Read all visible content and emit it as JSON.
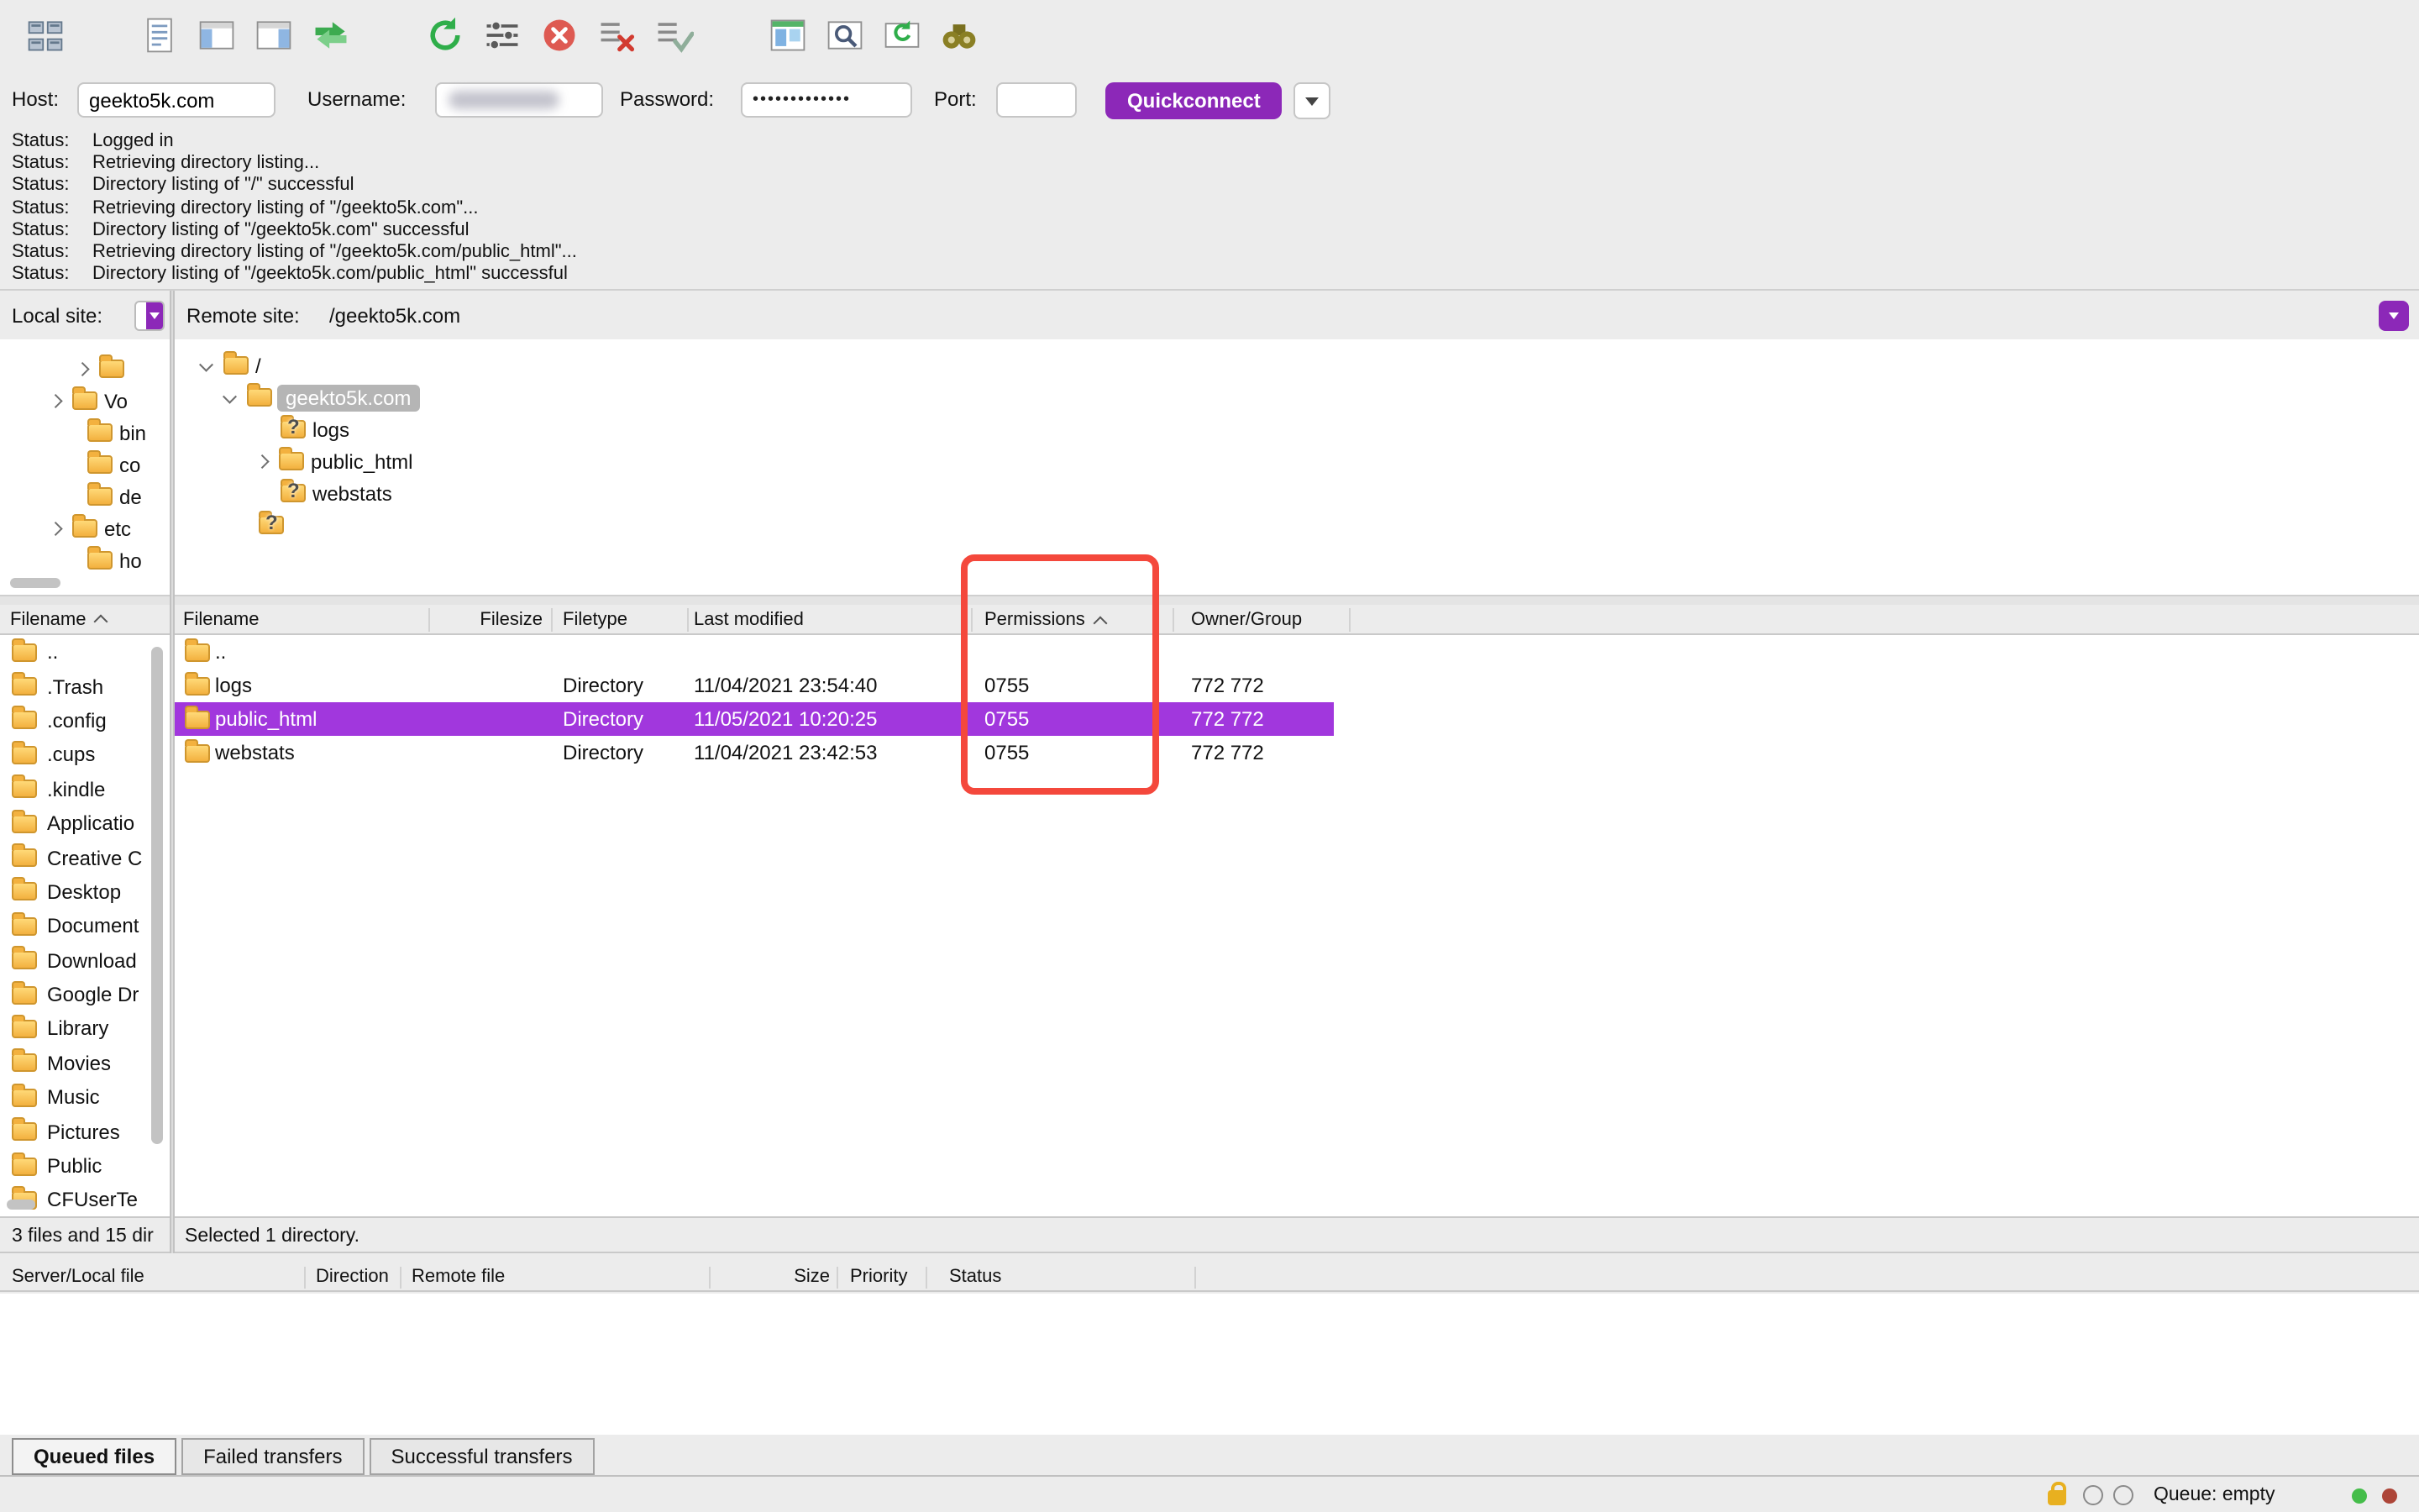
{
  "colors": {
    "selection": "#A137DD",
    "accent_purple": "#8C28B8",
    "highlight_box": "#F4483C",
    "folder": "#F3B13F"
  },
  "toolbar": {
    "icons": [
      "site-manager",
      "message-log-toggle",
      "local-tree-toggle",
      "remote-tree-toggle",
      "transfer-queue-toggle",
      "refresh",
      "filter",
      "cancel",
      "disconnect",
      "reconnect",
      "directory-comparison",
      "file-search",
      "synchronized-browsing",
      "find-files"
    ]
  },
  "quickconnect": {
    "host_label": "Host:",
    "host_value": "geekto5k.com",
    "username_label": "Username:",
    "username_value": "",
    "password_label": "Password:",
    "password_value": "•••••••••••••",
    "port_label": "Port:",
    "port_value": "",
    "button_label": "Quickconnect"
  },
  "status_log": {
    "lines": [
      {
        "label": "Status:",
        "message": "Logged in"
      },
      {
        "label": "Status:",
        "message": "Retrieving directory listing..."
      },
      {
        "label": "Status:",
        "message": "Directory listing of \"/\" successful"
      },
      {
        "label": "Status:",
        "message": "Retrieving directory listing of \"/geekto5k.com\"..."
      },
      {
        "label": "Status:",
        "message": "Directory listing of \"/geekto5k.com\" successful"
      },
      {
        "label": "Status:",
        "message": "Retrieving directory listing of \"/geekto5k.com/public_html\"..."
      },
      {
        "label": "Status:",
        "message": "Directory listing of \"/geekto5k.com/public_html\" successful"
      }
    ]
  },
  "site_bar": {
    "local_label": "Local site:",
    "remote_label": "Remote site:",
    "remote_value": "/geekto5k.com"
  },
  "local_tree": {
    "items": [
      {
        "label": "",
        "indent": 44,
        "chevron": "right"
      },
      {
        "label": "Vo",
        "indent": 28,
        "chevron": "right"
      },
      {
        "label": "bin",
        "indent": 52
      },
      {
        "label": "co",
        "indent": 52
      },
      {
        "label": "de",
        "indent": 52
      },
      {
        "label": "etc",
        "indent": 28,
        "chevron": "right"
      },
      {
        "label": "ho",
        "indent": 52
      }
    ]
  },
  "remote_tree": {
    "items": [
      {
        "label": "/",
        "indent": 14,
        "chevron": "down"
      },
      {
        "label": "geekto5k.com",
        "indent": 28,
        "chevron": "down",
        "selected": true
      },
      {
        "label": "logs",
        "indent": 63,
        "question": true
      },
      {
        "label": "public_html",
        "indent": 47,
        "chevron": "right"
      },
      {
        "label": "webstats",
        "indent": 63,
        "question": true
      },
      {
        "label": "",
        "indent": 50,
        "question": true
      }
    ]
  },
  "local_list": {
    "header": "Filename",
    "rows": [
      "..",
      ".Trash",
      ".config",
      ".cups",
      ".kindle",
      "Applicatio",
      "Creative C",
      "Desktop",
      "Document",
      "Download",
      "Google Dr",
      "Library",
      "Movies",
      "Music",
      "Pictures",
      "Public",
      "CFUserTe"
    ],
    "status": "3 files and 15 dir"
  },
  "remote_list": {
    "headers": [
      "Filename",
      "Filesize",
      "Filetype",
      "Last modified",
      "Permissions",
      "Owner/Group"
    ],
    "rows": [
      {
        "name": "..",
        "filesize": "",
        "filetype": "",
        "last_modified": "",
        "permissions": "",
        "owner_group": "",
        "selected": false
      },
      {
        "name": "logs",
        "filesize": "",
        "filetype": "Directory",
        "last_modified": "11/04/2021 23:54:40",
        "permissions": "0755",
        "owner_group": "772 772",
        "selected": false
      },
      {
        "name": "public_html",
        "filesize": "",
        "filetype": "Directory",
        "last_modified": "11/05/2021 10:20:25",
        "permissions": "0755",
        "owner_group": "772 772",
        "selected": true
      },
      {
        "name": "webstats",
        "filesize": "",
        "filetype": "Directory",
        "last_modified": "11/04/2021 23:42:53",
        "permissions": "0755",
        "owner_group": "772 772",
        "selected": false
      }
    ],
    "status": "Selected 1 directory."
  },
  "queue": {
    "headers": [
      "Server/Local file",
      "Direction",
      "Remote file",
      "Size",
      "Priority",
      "Status"
    ]
  },
  "tabs": [
    {
      "label": "Queued files",
      "active": true
    },
    {
      "label": "Failed transfers",
      "active": false
    },
    {
      "label": "Successful transfers",
      "active": false
    }
  ],
  "footer": {
    "queue_status": "Queue: empty"
  }
}
